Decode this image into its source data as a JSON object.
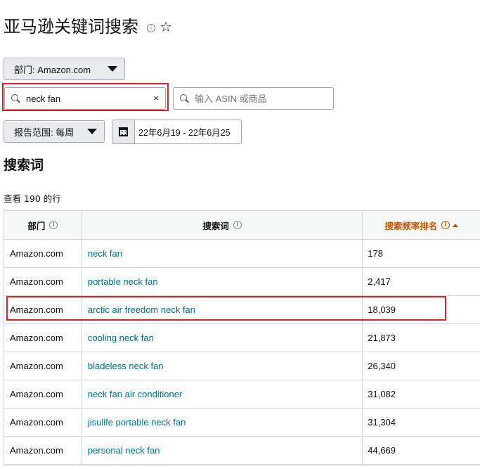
{
  "page": {
    "title": "亚马逊关键词搜索",
    "info_symbol": "i",
    "star_symbol": "☆"
  },
  "filters": {
    "department_label": "部门: Amazon.com",
    "search_value": "neck fan",
    "clear_symbol": "×",
    "asin_placeholder": "输入 ASIN 或商品",
    "report_range_label": "报告范围: 每周",
    "date_range": "22年6月19 - 22年6月25"
  },
  "section": {
    "title": "搜索词",
    "row_count": "查看 190 的行"
  },
  "table": {
    "columns": [
      "部门",
      "搜索词",
      "搜索频率排名"
    ],
    "rows": [
      {
        "department": "Amazon.com",
        "term": "neck fan",
        "rank": "178"
      },
      {
        "department": "Amazon.com",
        "term": "portable neck fan",
        "rank": "2,417"
      },
      {
        "department": "Amazon.com",
        "term": "arctic air freedom neck fan",
        "rank": "18,039"
      },
      {
        "department": "Amazon.com",
        "term": "cooling neck fan",
        "rank": "21,873"
      },
      {
        "department": "Amazon.com",
        "term": "bladeless neck fan",
        "rank": "26,340"
      },
      {
        "department": "Amazon.com",
        "term": "neck fan air conditioner",
        "rank": "31,082"
      },
      {
        "department": "Amazon.com",
        "term": "jisulife portable neck fan",
        "rank": "31,304"
      },
      {
        "department": "Amazon.com",
        "term": "personal neck fan",
        "rank": "44,669"
      }
    ]
  },
  "colors": {
    "link": "#007185",
    "sort_active": "#c45500",
    "highlight": "#e31b23"
  }
}
